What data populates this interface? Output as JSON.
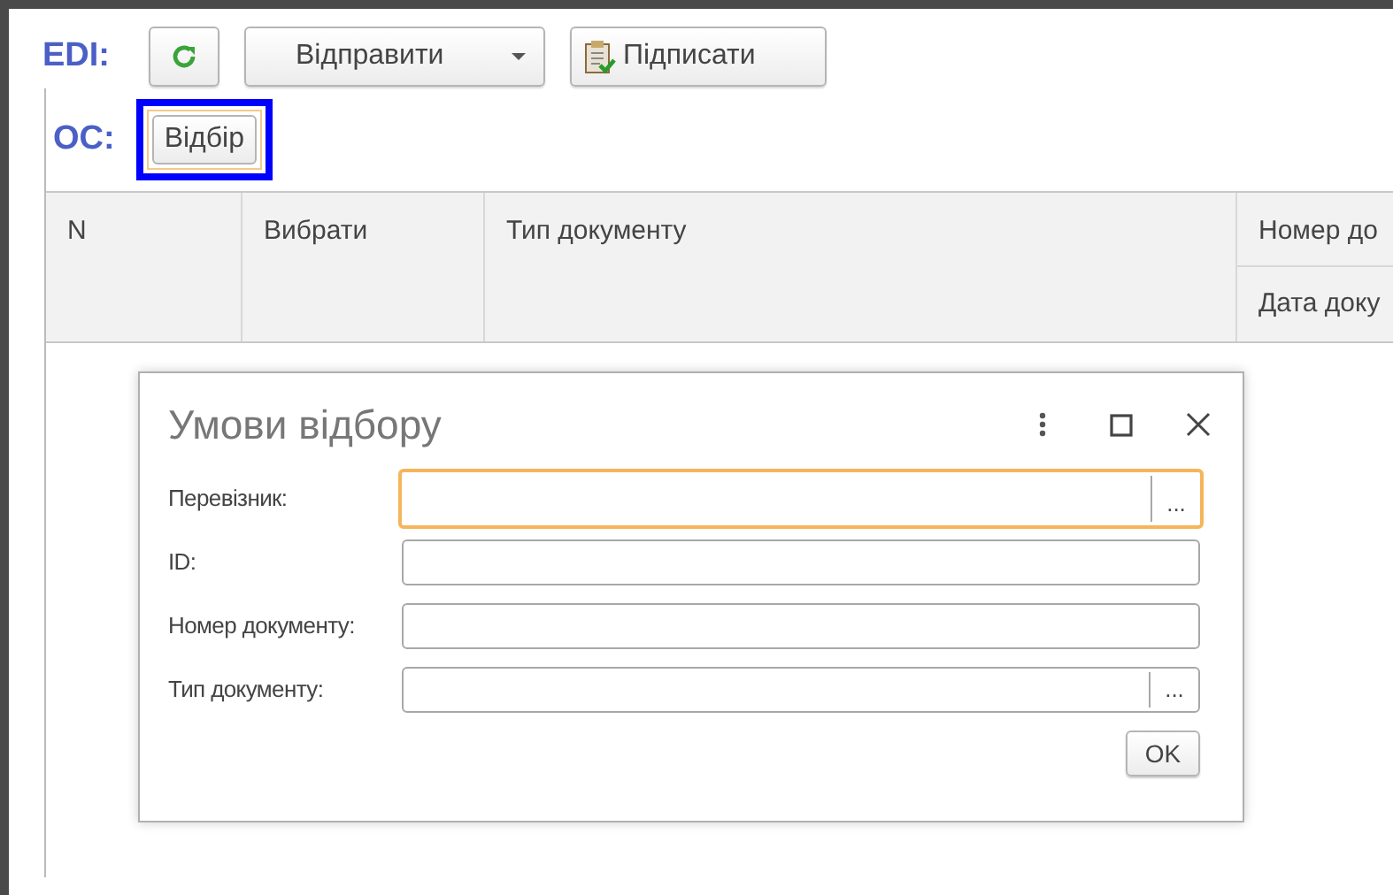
{
  "toolbar": {
    "label": "EDI:",
    "buttons": [
      {
        "kind": "refresh"
      },
      {
        "kind": "dropdown",
        "label": "Відправити"
      },
      {
        "kind": "sign",
        "label": "Підписати"
      }
    ]
  },
  "filter_bar": {
    "label": "ОС:",
    "button": {
      "label": "Відбір",
      "highlighted": true
    }
  },
  "table": {
    "columns": [
      {
        "label": "N"
      },
      {
        "label": "Вибрати"
      },
      {
        "label": "Тип документу"
      },
      {
        "label": "Номер до",
        "sub_label": "Дата доку"
      }
    ]
  },
  "dialog": {
    "title": "Умови відбору",
    "fields": [
      {
        "label": "Перевізник:",
        "kind": "choice",
        "focused": true,
        "button": "..."
      },
      {
        "label": "ID:",
        "kind": "text",
        "focused": false
      },
      {
        "label": "Номер документу:",
        "kind": "text",
        "focused": false
      },
      {
        "label": "Тип документу:",
        "kind": "choice",
        "focused": false,
        "button": "..."
      }
    ],
    "ok": "OK"
  }
}
